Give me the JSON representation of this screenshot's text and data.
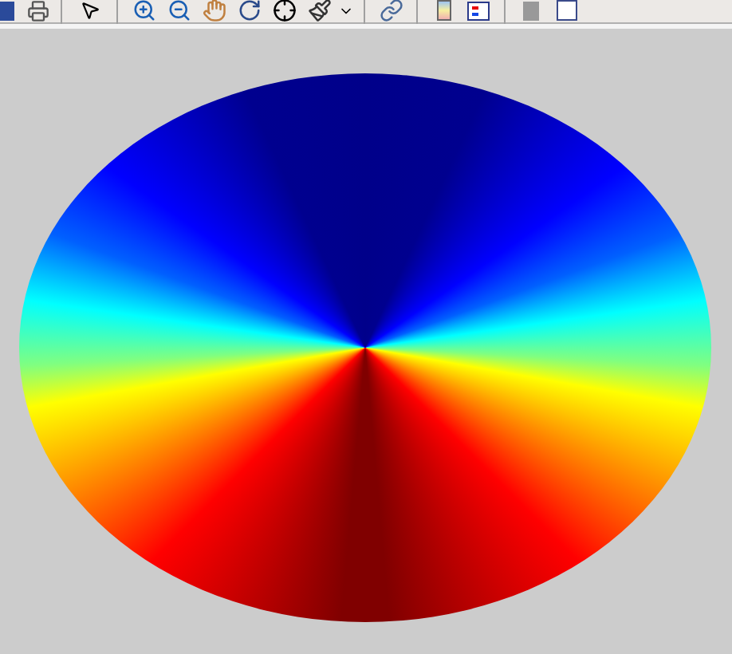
{
  "toolbar": {
    "buttons": [
      {
        "kind": "edge"
      },
      {
        "kind": "print"
      },
      {
        "kind": "separator"
      },
      {
        "kind": "pointer"
      },
      {
        "kind": "separator"
      },
      {
        "kind": "zoom-in"
      },
      {
        "kind": "zoom-out"
      },
      {
        "kind": "pan"
      },
      {
        "kind": "rotate"
      },
      {
        "kind": "cursor"
      },
      {
        "kind": "brush"
      },
      {
        "kind": "dropdown"
      },
      {
        "kind": "separator"
      },
      {
        "kind": "link"
      },
      {
        "kind": "separator"
      },
      {
        "kind": "colorbar"
      },
      {
        "kind": "legend"
      },
      {
        "kind": "separator"
      },
      {
        "kind": "hide-tools"
      },
      {
        "kind": "show-tools"
      }
    ]
  }
}
